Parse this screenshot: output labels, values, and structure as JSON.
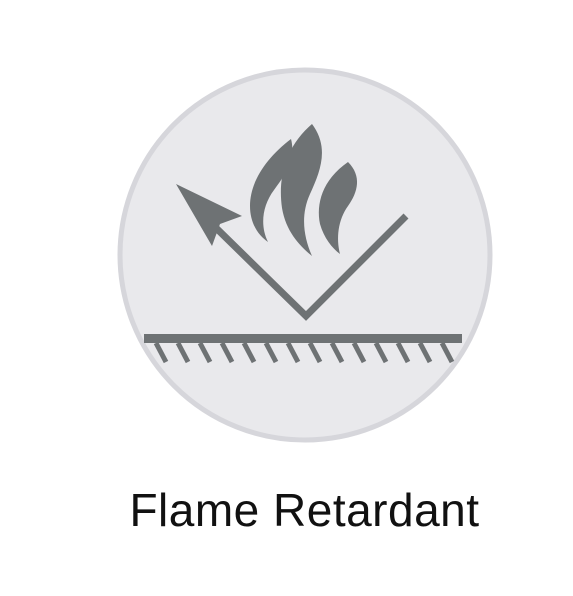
{
  "feature": {
    "label": "Flame Retardant",
    "icon": "flame-retardant-icon"
  },
  "colors": {
    "badge_fill": "#e9e9ec",
    "badge_ring": "#d6d6db",
    "icon_fill": "#6e7274",
    "text": "#111111",
    "background": "#ffffff"
  }
}
